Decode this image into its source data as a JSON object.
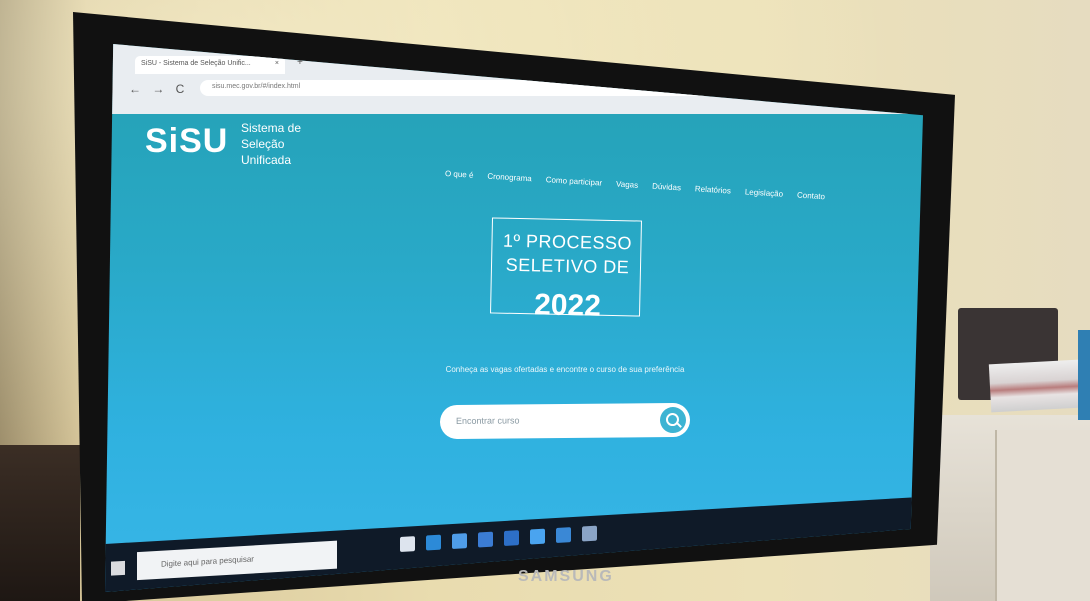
{
  "photo": {
    "monitor_brand": "SAMSUNG"
  },
  "browser": {
    "tab_title": "SiSU - Sistema de Seleção Unific...",
    "tab_close": "×",
    "new_tab": "+",
    "nav": "← → C",
    "url": "sisu.mec.gov.br/#/index.html"
  },
  "site": {
    "logo": "SiSU",
    "logo_sub": [
      "Sistema de",
      "Seleção",
      "Unificada"
    ],
    "menu": [
      "O que é",
      "Cronograma",
      "Como participar",
      "Vagas",
      "Dúvidas",
      "Relatórios",
      "Legislação",
      "Contato"
    ],
    "hero_line1": "1º PROCESSO",
    "hero_line2": "SELETIVO DE",
    "hero_year": "2022",
    "description": "Conheça as vagas ofertadas e encontre o curso de sua preferência",
    "search_placeholder": "Encontrar curso"
  },
  "taskbar": {
    "search_placeholder": "Digite aqui para pesquisar"
  }
}
